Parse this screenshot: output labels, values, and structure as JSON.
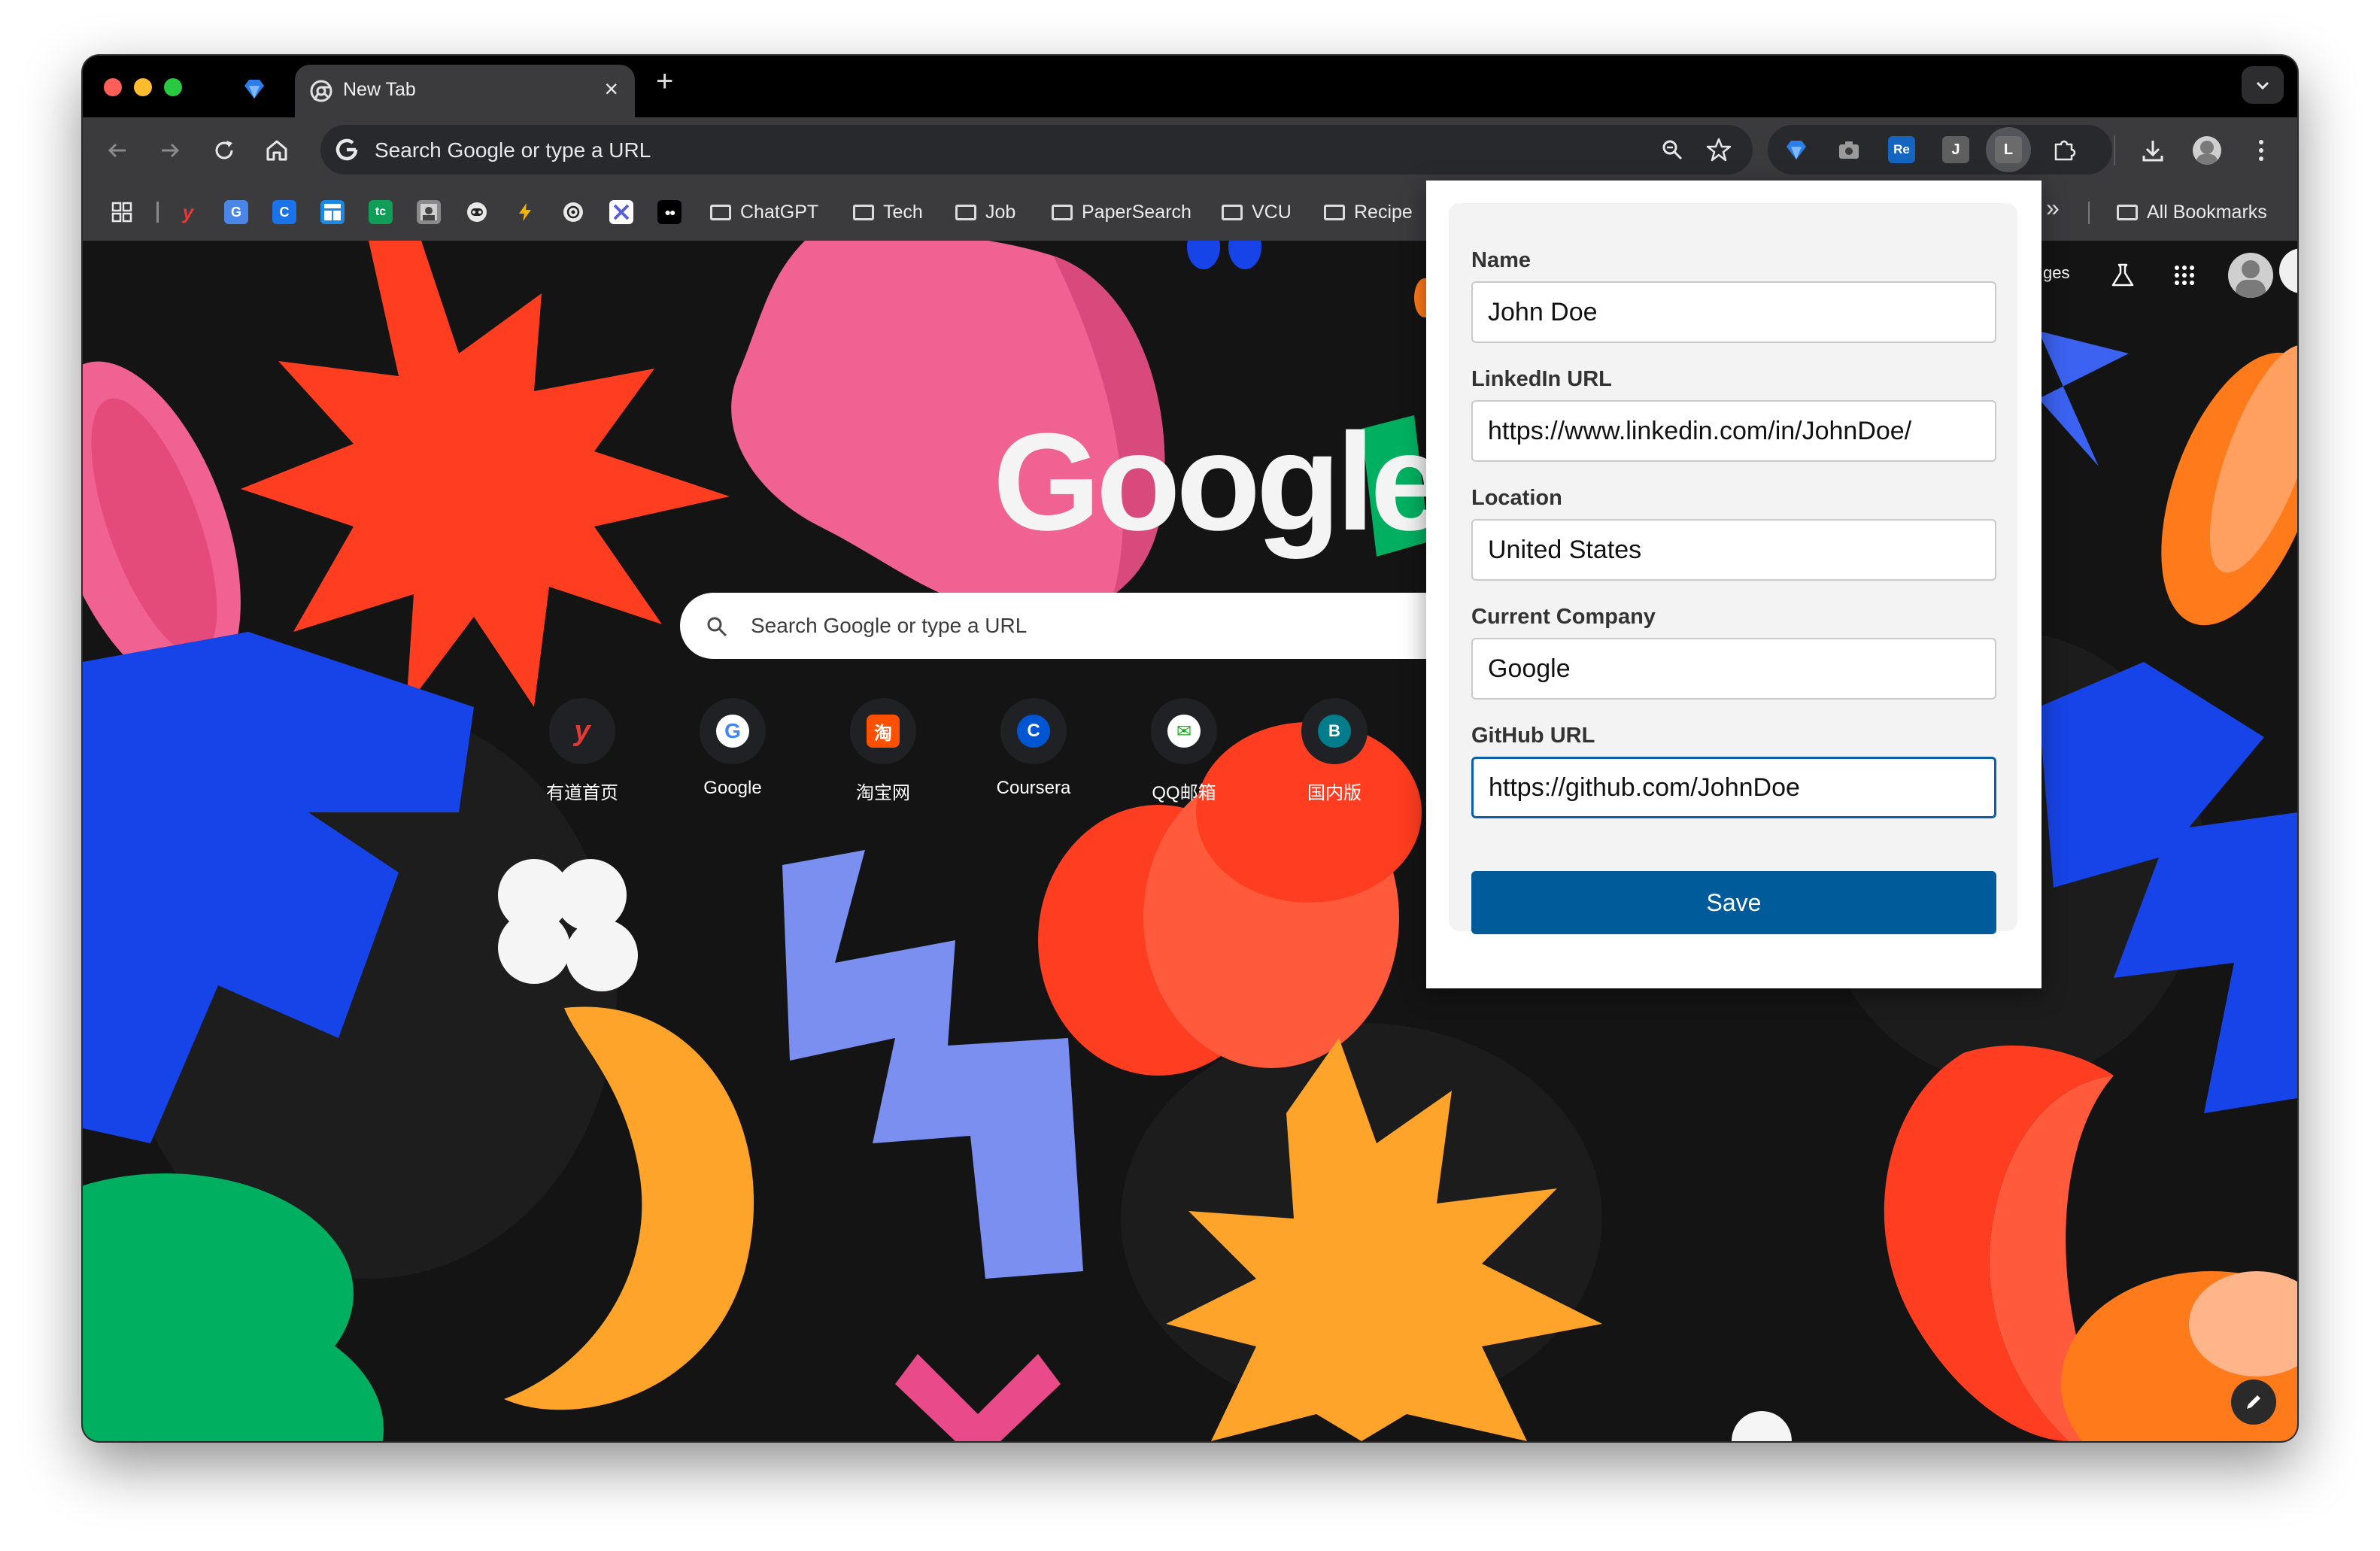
{
  "window": {
    "tabs": [
      {
        "title": "New Tab",
        "close": "×"
      }
    ],
    "new_tab_symbol": "+"
  },
  "toolbar": {
    "omnibox_placeholder": "Search Google or type a URL",
    "extensions": [
      {
        "name": "gem-extension",
        "text": ""
      },
      {
        "name": "camera-extension",
        "text": ""
      },
      {
        "name": "re-extension",
        "text": "Re"
      },
      {
        "name": "j-extension",
        "text": "J"
      },
      {
        "name": "l-extension",
        "text": "L"
      },
      {
        "name": "puzzle-extension",
        "text": ""
      }
    ]
  },
  "bookmarks": {
    "icons": [
      {
        "name": "apps-icon",
        "text": "",
        "color": "#3b3b3e"
      },
      {
        "name": "youdao-bookmark",
        "text": "y",
        "color": "#3b3b3e"
      },
      {
        "name": "translate-bookmark",
        "text": "G",
        "color": "#4a86e8"
      },
      {
        "name": "c-bookmark",
        "text": "C",
        "color": "#1a73e8"
      },
      {
        "name": "grid-bookmark",
        "text": "",
        "color": "#1e88e5"
      },
      {
        "name": "tc-bookmark",
        "text": "tc",
        "color": "#0f9d58"
      },
      {
        "name": "photo-bookmark",
        "text": "",
        "color": "#777777"
      },
      {
        "name": "bot-bookmark",
        "text": "",
        "color": "#222222"
      },
      {
        "name": "bolt-bookmark",
        "text": "",
        "color": "#222222"
      },
      {
        "name": "openai-bookmark",
        "text": "",
        "color": "#222222"
      },
      {
        "name": "tools-bookmark",
        "text": "",
        "color": "#5b5fd6"
      },
      {
        "name": "medium-bookmark",
        "text": "●●",
        "color": "#000000"
      }
    ],
    "folders": [
      "ChatGPT",
      "Tech",
      "Job",
      "PaperSearch",
      "VCU",
      "Recipe"
    ],
    "overflow": "»",
    "all_bookmarks": "All Bookmarks"
  },
  "ntp": {
    "logo": "Google",
    "search_placeholder": "Search Google or type a URL",
    "header_partial": "ges",
    "shortcuts": [
      {
        "label": "有道首页",
        "letter": "y",
        "bg": "#202124",
        "fg": "#e53935"
      },
      {
        "label": "Google",
        "letter": "G",
        "bg": "#ffffff",
        "fg": "#4285f4"
      },
      {
        "label": "淘宝网",
        "letter": "淘",
        "bg": "#ff5000",
        "fg": "#ffffff"
      },
      {
        "label": "Coursera",
        "letter": "C",
        "bg": "#0056d2",
        "fg": "#ffffff"
      },
      {
        "label": "QQ邮箱",
        "letter": "✉",
        "bg": "#ffffff",
        "fg": "#1aad19"
      },
      {
        "label": "国内版",
        "letter": "B",
        "bg": "#007c8a",
        "fg": "#ffffff"
      }
    ]
  },
  "popup": {
    "fields": [
      {
        "label": "Name",
        "value": "John Doe"
      },
      {
        "label": "LinkedIn URL",
        "value": "https://www.linkedin.com/in/JohnDoe/"
      },
      {
        "label": "Location",
        "value": "United States"
      },
      {
        "label": "Current Company",
        "value": "Google"
      },
      {
        "label": "GitHub URL",
        "value": "https://github.com/JohnDoe"
      }
    ],
    "save_label": "Save",
    "accent": "#005b9a"
  }
}
